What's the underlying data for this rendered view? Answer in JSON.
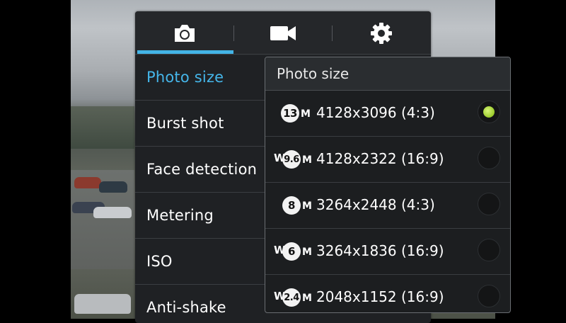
{
  "tabs": [
    {
      "name": "camera-icon",
      "selected": true
    },
    {
      "name": "video-camera-icon",
      "selected": false
    },
    {
      "name": "gear-icon",
      "selected": false
    }
  ],
  "menu": {
    "items": [
      {
        "label": "Photo size",
        "active": true
      },
      {
        "label": "Burst shot",
        "active": false
      },
      {
        "label": "Face detection",
        "active": false
      },
      {
        "label": "Metering",
        "active": false
      },
      {
        "label": "ISO",
        "active": false
      },
      {
        "label": "Anti-shake",
        "active": false
      }
    ]
  },
  "popup": {
    "title": "Photo size",
    "options": [
      {
        "prefix": "",
        "mp": "13",
        "suffix": "M",
        "label": "4128x3096 (4:3)",
        "selected": true
      },
      {
        "prefix": "W",
        "mp": "9.6",
        "suffix": "M",
        "label": "4128x2322 (16:9)",
        "selected": false
      },
      {
        "prefix": "",
        "mp": "8",
        "suffix": "M",
        "label": "3264x2448 (4:3)",
        "selected": false
      },
      {
        "prefix": "W",
        "mp": "6",
        "suffix": "M",
        "label": "3264x1836 (16:9)",
        "selected": false
      },
      {
        "prefix": "W",
        "mp": "2.4",
        "suffix": "M",
        "label": "2048x1152 (16:9)",
        "selected": false
      }
    ]
  },
  "colors": {
    "accent": "#43b4e6",
    "selected_radio": "#a3d42e",
    "panel_bg": "#1f2124"
  }
}
